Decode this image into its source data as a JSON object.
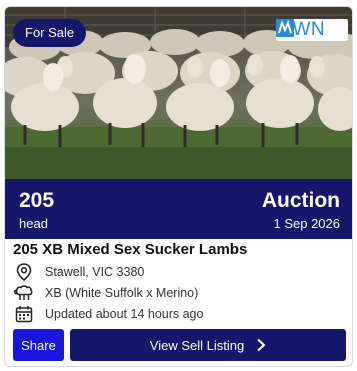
{
  "listing": {
    "status_badge": "For Sale",
    "brand_logo_text": "AWN",
    "head_count": "205",
    "head_unit": "head",
    "sale_type": "Auction",
    "sale_date": "1 Sep 2026",
    "title": "205 XB Mixed Sex Sucker Lambs",
    "location": "Stawell, VIC 3380",
    "breed": "XB (White Suffolk x Merino)",
    "updated": "Updated about 14 hours ago"
  },
  "actions": {
    "share_label": "Share",
    "view_label": "View Sell Listing"
  },
  "icons": {
    "location": "map-pin-icon",
    "breed": "sheep-icon",
    "updated": "calendar-icon",
    "view": "chevron-right-icon"
  },
  "colors": {
    "navy": "#16166b",
    "share_blue": "#1a14e0",
    "awn_blue": "#2a8bd6"
  }
}
